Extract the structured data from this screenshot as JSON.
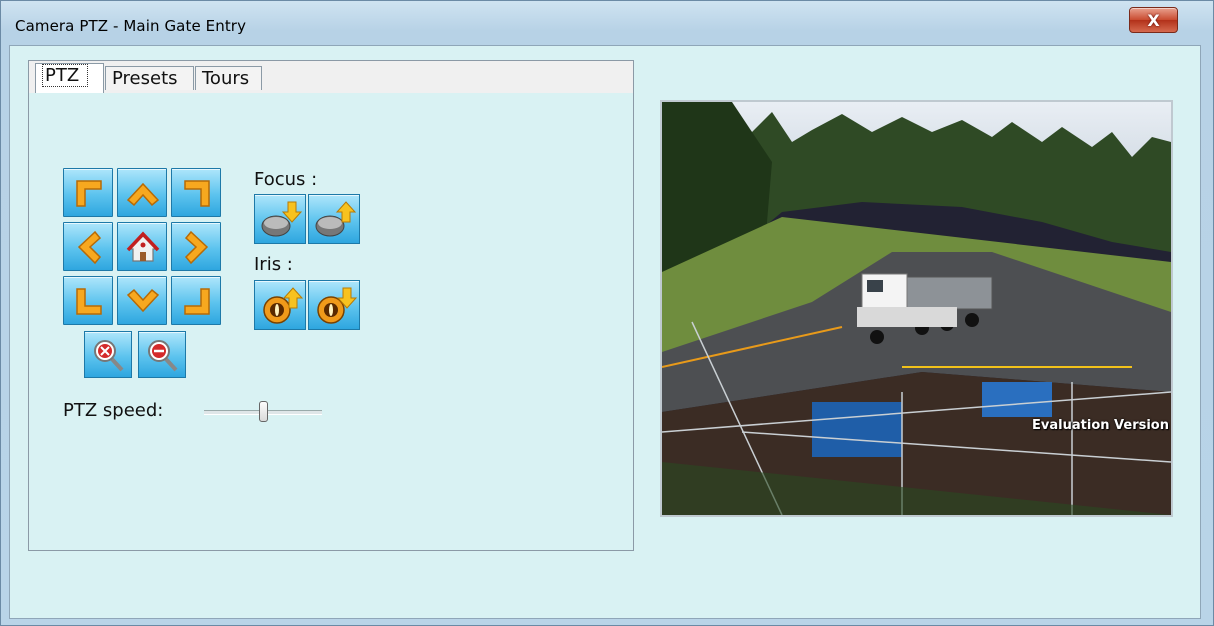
{
  "window": {
    "title": "Camera PTZ - Main Gate Entry",
    "close_label": "X"
  },
  "tabs": [
    {
      "label": "PTZ"
    },
    {
      "label": "Presets"
    },
    {
      "label": "Tours"
    }
  ],
  "ptz": {
    "focus_label": "Focus :",
    "iris_label": "Iris :",
    "speed_label": "PTZ speed:",
    "speed_level": 0.5
  },
  "video": {
    "watermark": "Evaluation Version"
  },
  "icons": {
    "pan": [
      "arrow-up-left-icon",
      "arrow-up-icon",
      "arrow-up-right-icon",
      "arrow-left-icon",
      "home-icon",
      "arrow-right-icon",
      "arrow-down-left-icon",
      "arrow-down-icon",
      "arrow-down-right-icon"
    ],
    "zoom": [
      "zoom-in-icon",
      "zoom-out-icon"
    ],
    "focus": [
      "focus-near-icon",
      "focus-far-icon"
    ],
    "iris": [
      "iris-open-icon",
      "iris-close-icon"
    ]
  },
  "colors": {
    "button_blue": "#5cc3ee",
    "arrow_orange": "#f5a21b",
    "panel_bg": "#d9f2f3"
  }
}
